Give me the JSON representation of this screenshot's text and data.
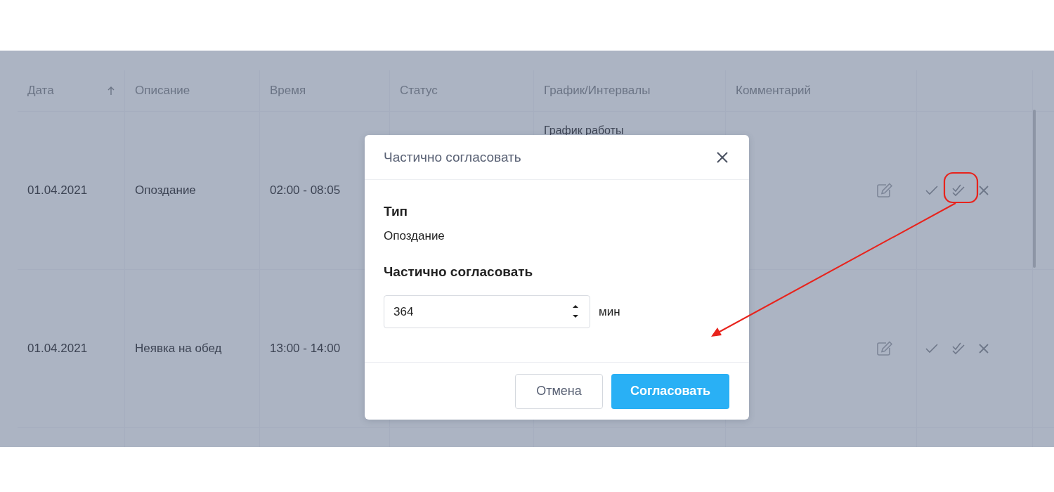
{
  "columns": [
    {
      "label": "Дата",
      "sorted": true
    },
    {
      "label": "Описание",
      "sorted": false
    },
    {
      "label": "Время",
      "sorted": false
    },
    {
      "label": "Статус",
      "sorted": false
    },
    {
      "label": "График/Интервалы",
      "sorted": false
    },
    {
      "label": "Комментарий",
      "sorted": false
    }
  ],
  "rows": [
    {
      "date": "01.04.2021",
      "description": "Опоздание",
      "time": "02:00 - 08:05",
      "schedule": "График работы"
    },
    {
      "date": "01.04.2021",
      "description": "Неявка на обед",
      "time": "13:00 - 14:00"
    }
  ],
  "dialog": {
    "title": "Частично согласовать",
    "type_label": "Тип",
    "type_value": "Опоздание",
    "amount_label": "Частично согласовать",
    "amount_value": "364",
    "unit": "мин",
    "buttons": [
      {
        "label": "Отмена",
        "kind": "secondary"
      },
      {
        "label": "Согласовать",
        "kind": "primary"
      }
    ]
  }
}
